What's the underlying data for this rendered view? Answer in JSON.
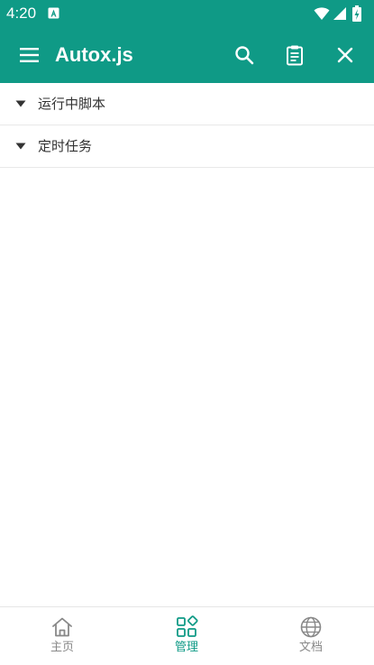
{
  "status_bar": {
    "time": "4:20",
    "icons": [
      "app-notification-icon",
      "wifi-icon",
      "signal-icon",
      "battery-icon"
    ]
  },
  "toolbar": {
    "menu_icon": "menu-icon",
    "title": "Autox.js",
    "actions": [
      "search-icon",
      "log-icon",
      "close-icon"
    ]
  },
  "groups": [
    {
      "label": "运行中脚本",
      "expanded": true
    },
    {
      "label": "定时任务",
      "expanded": true
    }
  ],
  "bottom_nav": {
    "items": [
      {
        "label": "主页",
        "icon": "home-icon",
        "active": false
      },
      {
        "label": "管理",
        "icon": "manage-icon",
        "active": true
      },
      {
        "label": "文档",
        "icon": "globe-icon",
        "active": false
      }
    ]
  },
  "colors": {
    "primary": "#0f9a86",
    "on_primary": "#ffffff",
    "nav_active": "#0f9a86",
    "nav_inactive": "#888888",
    "text": "#333333"
  }
}
